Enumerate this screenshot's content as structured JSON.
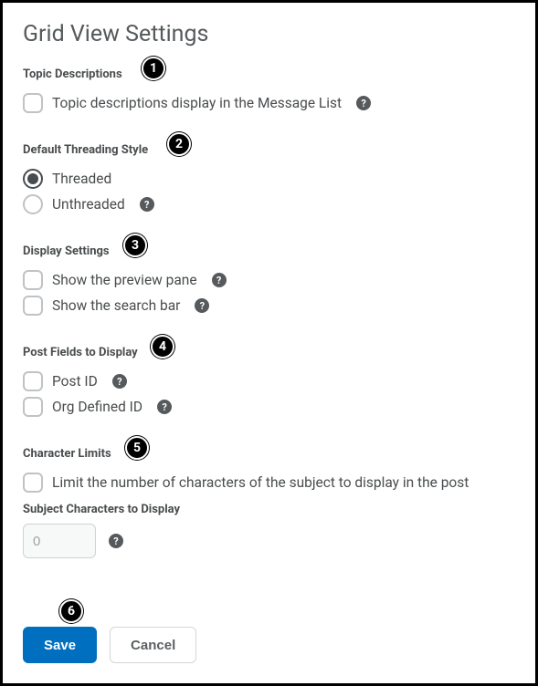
{
  "title": "Grid View Settings",
  "sections": {
    "topicDescriptions": {
      "label": "Topic Descriptions",
      "option": "Topic descriptions display in the Message List"
    },
    "threading": {
      "label": "Default Threading Style",
      "options": {
        "threaded": "Threaded",
        "unthreaded": "Unthreaded"
      },
      "selected": "threaded"
    },
    "display": {
      "label": "Display Settings",
      "options": {
        "preview": "Show the preview pane",
        "search": "Show the search bar"
      }
    },
    "postFields": {
      "label": "Post Fields to Display",
      "options": {
        "postId": "Post ID",
        "orgId": "Org Defined ID"
      }
    },
    "charLimits": {
      "label": "Character Limits",
      "option": "Limit the number of characters of the subject to display in the post",
      "subLabel": "Subject Characters to Display",
      "value": "0"
    }
  },
  "buttons": {
    "save": "Save",
    "cancel": "Cancel"
  },
  "helpGlyph": "?",
  "annotations": [
    "1",
    "2",
    "3",
    "4",
    "5",
    "6"
  ]
}
